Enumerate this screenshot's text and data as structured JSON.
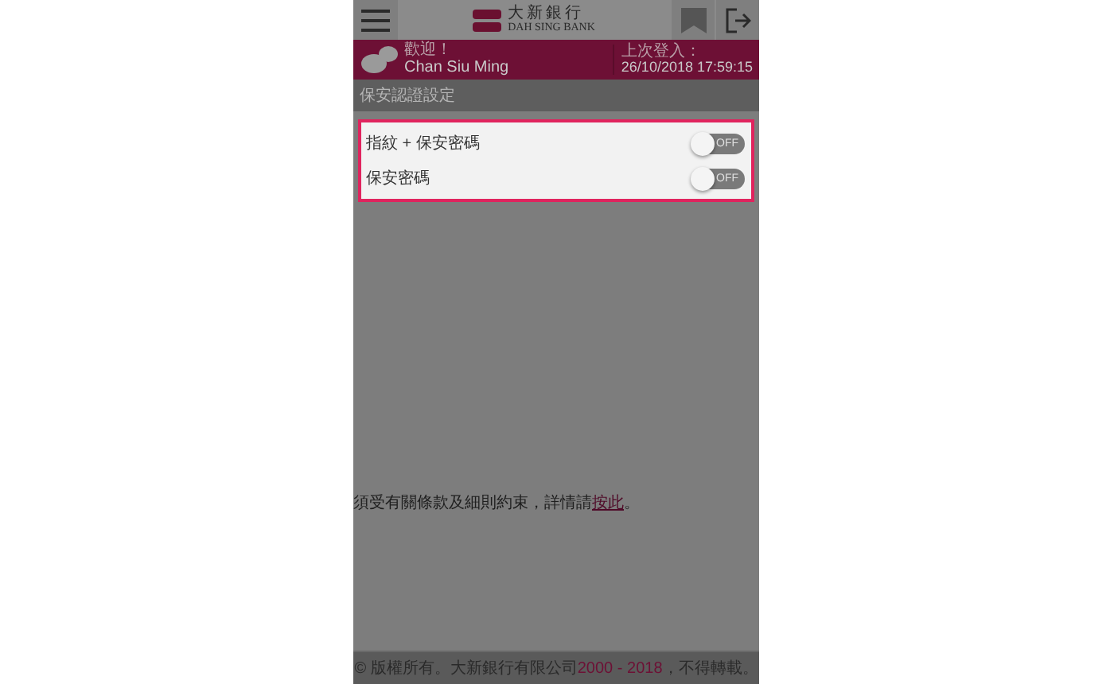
{
  "header": {
    "logo_chinese": "大新銀行",
    "logo_english": "DAH SING BANK"
  },
  "welcome": {
    "greeting": "歡迎！",
    "name": "Chan Siu Ming",
    "last_login_label": "上次登入：",
    "last_login": "26/10/2018 17:59:15"
  },
  "section_title": "保安認證設定",
  "settings": [
    {
      "label": "指紋 + 保安密碼",
      "toggle_text": "OFF",
      "on": false
    },
    {
      "label": "保安密碼",
      "toggle_text": "OFF",
      "on": false
    }
  ],
  "notice": {
    "text": "須受有關條款及細則約束，詳情請",
    "link": "按此",
    "end": "。"
  },
  "footer": {
    "before": "© 版權所有。大新銀行有限公司 ",
    "years": "2000 - 2018",
    "after": "，不得轉載。"
  }
}
